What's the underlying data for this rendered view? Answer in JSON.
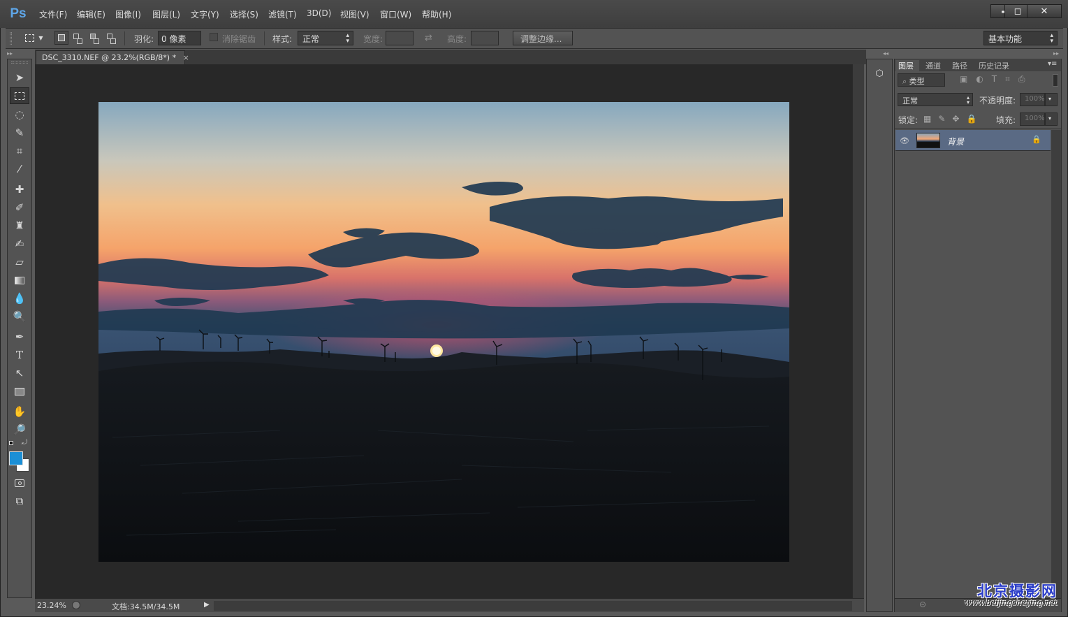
{
  "app": {
    "logo": "Ps"
  },
  "menu": {
    "items": [
      "文件(F)",
      "编辑(E)",
      "图像(I)",
      "图层(L)",
      "文字(Y)",
      "选择(S)",
      "滤镜(T)",
      "3D(D)",
      "视图(V)",
      "窗口(W)",
      "帮助(H)"
    ]
  },
  "window_controls": {
    "minimize": "▬",
    "maximize": "◻",
    "close": "✕"
  },
  "options": {
    "feather_label": "羽化:",
    "feather_value": "0 像素",
    "antialias_label": "消除锯齿",
    "style_label": "样式:",
    "style_value": "正常",
    "width_label": "宽度:",
    "height_label": "高度:",
    "refine_edge_button": "调整边缘...",
    "workspace_value": "基本功能"
  },
  "document": {
    "tab_title": "DSC_3310.NEF @ 23.2%(RGB/8*) *",
    "tab_close": "×",
    "zoom_status": "23.24%",
    "doc_size": "文档:34.5M/34.5M"
  },
  "colors": {
    "foreground": "#1b8fd6",
    "background": "#ffffff",
    "accent": "#5ea6e8",
    "layer_selected": "#5a6a84"
  },
  "panels": {
    "tabs": [
      "图层",
      "通道",
      "路径",
      "历史记录"
    ],
    "filter_kind": "类型",
    "blend_mode": "正常",
    "opacity_label": "不透明度:",
    "opacity_value": "100%",
    "lock_label": "锁定:",
    "fill_label": "填充:",
    "fill_value": "100%",
    "layers": [
      {
        "name": "背景",
        "visible": true,
        "locked": true
      }
    ]
  },
  "watermark": {
    "brand": "北京摄影网",
    "url": "www.beijingsheying.net"
  },
  "icons": {
    "tools": [
      "move-icon",
      "marquee-icon",
      "lasso-icon",
      "quick-select-icon",
      "crop-icon",
      "eyedropper-icon",
      "healing-icon",
      "brush-icon",
      "stamp-icon",
      "history-brush-icon",
      "eraser-icon",
      "gradient-icon",
      "blur-icon",
      "dodge-icon",
      "pen-icon",
      "type-icon",
      "path-select-icon",
      "shape-icon",
      "hand-icon",
      "zoom-icon"
    ]
  }
}
